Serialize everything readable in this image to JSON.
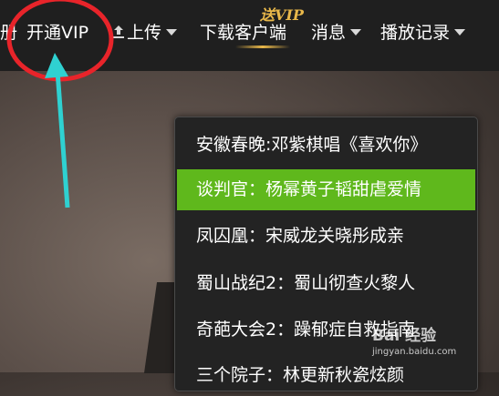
{
  "topbar": {
    "nav": [
      {
        "label": "册",
        "has_dropdown": false
      },
      {
        "label": "开通VIP",
        "has_dropdown": false
      },
      {
        "label": "上传",
        "has_dropdown": true,
        "icon": "upload-icon"
      },
      {
        "label": "下载客户端",
        "has_dropdown": false
      },
      {
        "label": "消息",
        "has_dropdown": true
      },
      {
        "label": "播放记录",
        "has_dropdown": true
      }
    ],
    "promo": "送VIP"
  },
  "history_dropdown": {
    "items": [
      {
        "label": "安徽春晚:邓紫棋唱《喜欢你》",
        "active": false
      },
      {
        "label": "谈判官：杨幂黄子韬甜虐爱情",
        "active": true
      },
      {
        "label": "凤囚凰：宋威龙关晓彤成亲",
        "active": false
      },
      {
        "label": "蜀山战纪2：蜀山彻查火黎人",
        "active": false
      },
      {
        "label": "奇葩大会2：躁郁症自救指南",
        "active": false
      },
      {
        "label": "三个院子：林更新秋瓷炫颜",
        "active": false
      }
    ]
  },
  "annotation": {
    "circle_color": "#e8242a",
    "arrow_color": "#2fd1d1"
  },
  "watermark": {
    "brand": "Bai 经验",
    "url": "jingyan.baidu.com"
  },
  "colors": {
    "active_item": "#5fb81c",
    "topbar": "#1f1f1f",
    "promo": "#e9b84a"
  }
}
